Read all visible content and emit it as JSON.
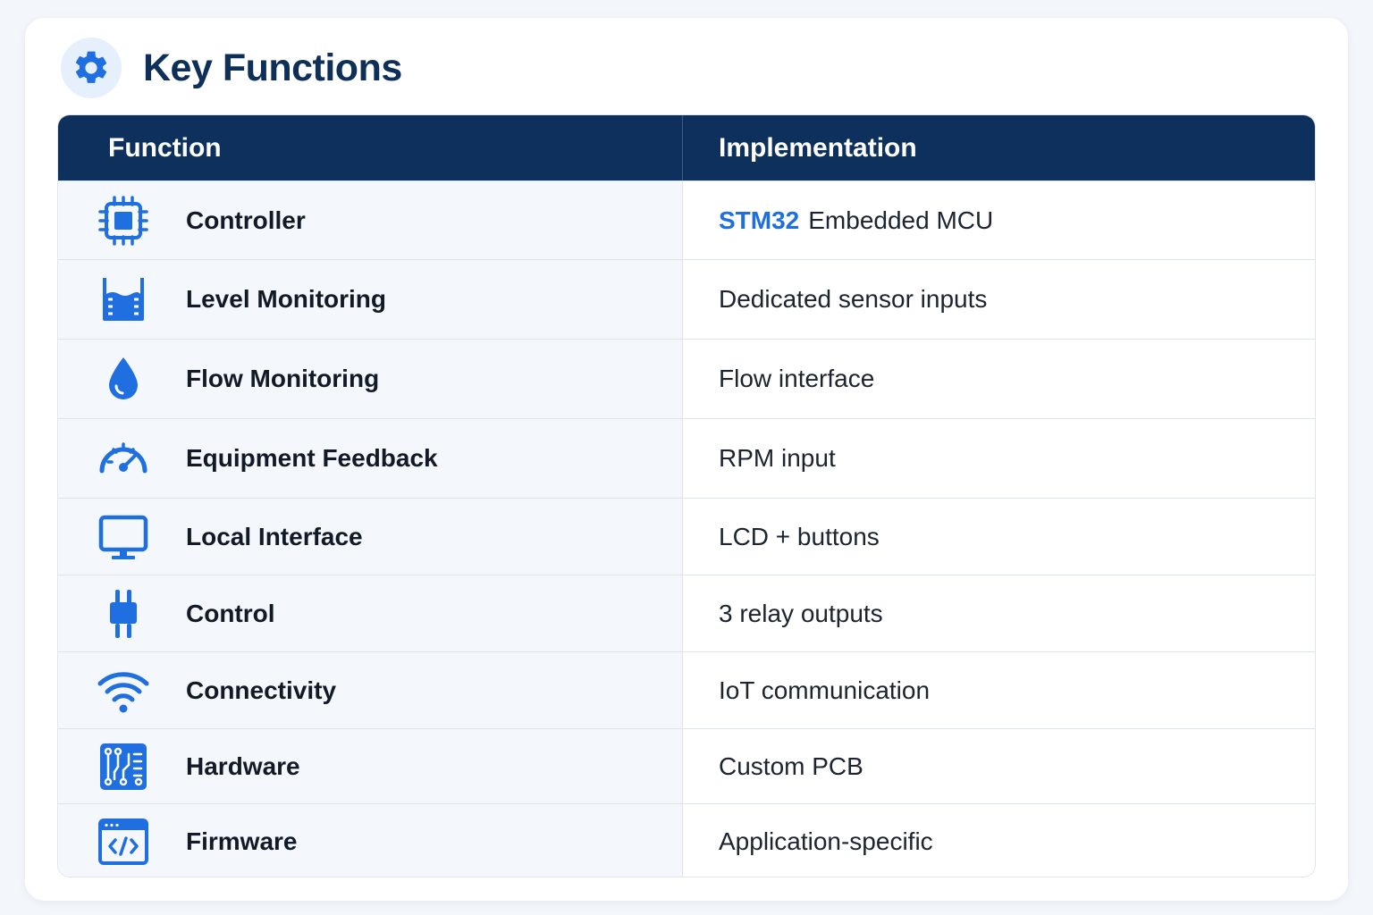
{
  "header": {
    "title": "Key Functions",
    "icon": "gear-icon"
  },
  "colors": {
    "navy": "#0d315c",
    "accent": "#1f6fe0",
    "icon_blue": "#1f6fe0"
  },
  "table": {
    "columns": [
      "Function",
      "Implementation"
    ],
    "rows": [
      {
        "function": "Controller",
        "icon": "microchip-icon",
        "impl_highlight": "STM32",
        "implementation": "Embedded MCU"
      },
      {
        "function": "Level Monitoring",
        "icon": "tank-level-icon",
        "implementation": "Dedicated sensor inputs"
      },
      {
        "function": "Flow Monitoring",
        "icon": "water-drop-icon",
        "implementation": "Flow interface"
      },
      {
        "function": "Equipment Feedback",
        "icon": "gauge-icon",
        "implementation": "RPM input"
      },
      {
        "function": "Local Interface",
        "icon": "monitor-icon",
        "implementation": "LCD + buttons"
      },
      {
        "function": "Control",
        "icon": "plug-icon",
        "implementation": "3 relay outputs"
      },
      {
        "function": "Connectivity",
        "icon": "wifi-icon",
        "implementation": "IoT communication"
      },
      {
        "function": "Hardware",
        "icon": "circuit-board-icon",
        "implementation": "Custom PCB"
      },
      {
        "function": "Firmware",
        "icon": "code-window-icon",
        "implementation": "Application-specific"
      }
    ]
  }
}
